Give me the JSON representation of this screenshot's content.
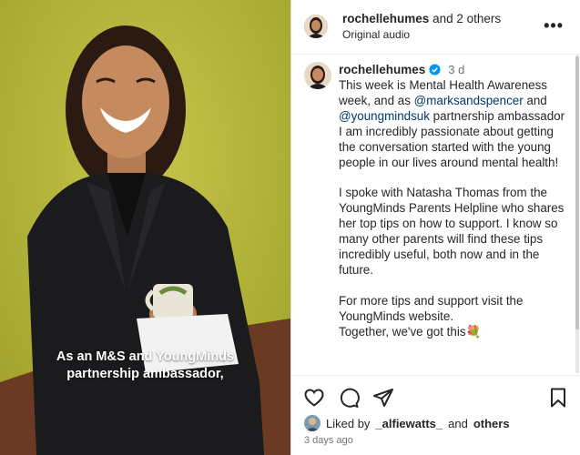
{
  "post": {
    "author": "rochellehumes",
    "coauthors_text": "and 2 others",
    "audio": "Original audio",
    "more_label": "•••"
  },
  "video": {
    "caption_line1": "As an M&S and YoungMinds",
    "caption_line2": "partnership ambassador,"
  },
  "comment": {
    "user": "rochellehumes",
    "time": "3 d",
    "text_1": "This week is Mental Health Awareness week, and as ",
    "mention_1": "@marksandspencer",
    "text_2": " and ",
    "mention_2": "@youngmindsuk",
    "text_3": " partnership ambassador I am incredibly passionate about getting the conversation started with the young people in our lives around mental health!\n\nI spoke with Natasha Thomas from the YoungMinds Parents Helpline who shares her top tips on how to support. I know so many other parents will find these tips incredibly useful, both now and in the future.\n\nFor more tips and support visit the YoungMinds website.\nTogether, we've got this",
    "emoji": "💐"
  },
  "likes": {
    "prefix": "Liked by",
    "user": "_alfiewatts_",
    "and": "and",
    "others": "others"
  },
  "timestamp": "3 days ago",
  "colors": {
    "accent": "#00376b",
    "verified": "#0095f6",
    "background_video": "#b5b63a"
  }
}
